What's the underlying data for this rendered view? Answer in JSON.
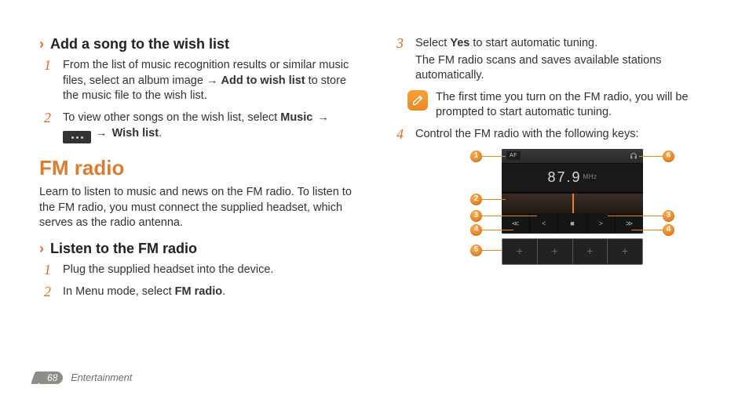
{
  "col1": {
    "h_wish": "Add a song to the wish list",
    "wish_step1_a": "From the list of music recognition results or similar music files, select an album image →",
    "wish_step1_bold": "Add to wish list",
    "wish_step1_b": "to store the music file to the wish list.",
    "wish_step2_a": "To view other songs on the wish list, select",
    "wish_step2_music": "Music",
    "wish_step2_arrow1": "→",
    "wish_step2_arrow2": "→",
    "wish_step2_wl": "Wish list",
    "wish_step2_period": ".",
    "section_title": "FM radio",
    "fm_intro": "Learn to listen to music and news on the FM radio. To listen to the FM radio, you must connect the supplied headset, which serves as the radio antenna.",
    "h_listen": "Listen to the FM radio",
    "listen_step1": "Plug the supplied headset into the device.",
    "listen_step2_a": "In Menu mode, select",
    "listen_step2_bold": "FM radio",
    "listen_step2_period": "."
  },
  "col2": {
    "step3_a": "Select",
    "step3_yes": "Yes",
    "step3_b": "to start automatic tuning.",
    "step3_sub": "The FM radio scans and saves available stations automatically.",
    "note": "The first time you turn on the FM radio, you will be prompted to start automatic tuning.",
    "step4": "Control the FM radio with the following keys:",
    "radio": {
      "af": "AF",
      "freq": "87.9",
      "mhz": "MHz",
      "callouts": {
        "c1": "1",
        "c2": "2",
        "c3": "3",
        "c4": "4",
        "c5": "5",
        "c6": "6"
      }
    }
  },
  "footer": {
    "page": "68",
    "section": "Entertainment"
  },
  "nums": {
    "n1": "1",
    "n2": "2",
    "n3": "3",
    "n4": "4"
  }
}
